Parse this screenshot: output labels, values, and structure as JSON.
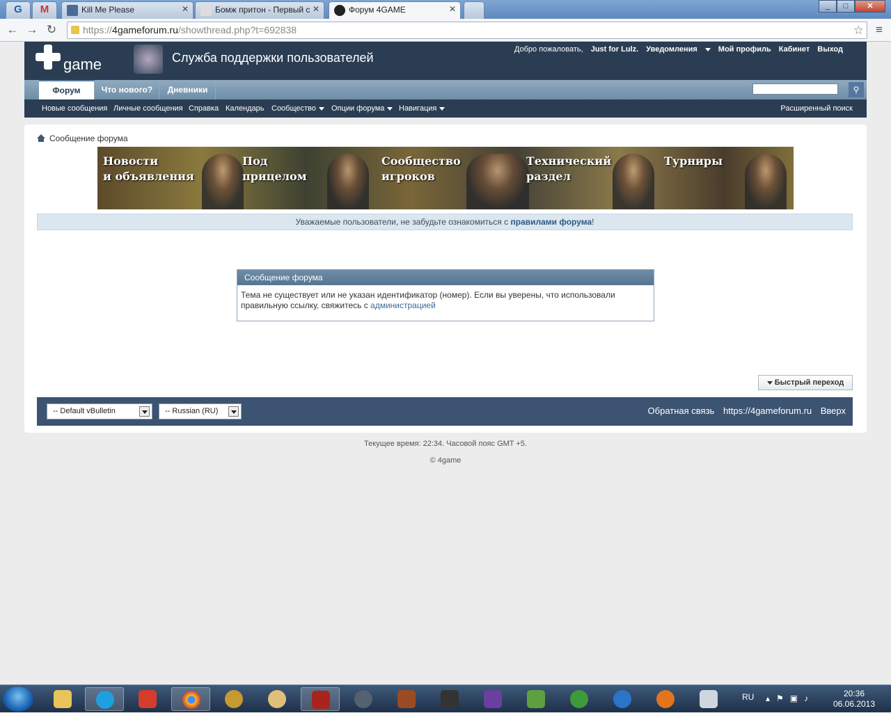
{
  "browser": {
    "tabs": [
      {
        "title": "",
        "icon": "4game-g-icon"
      },
      {
        "title": "",
        "icon": "gmail-icon"
      },
      {
        "title": "Kill Me Please",
        "icon": "video-icon"
      },
      {
        "title": "Бомж притон - Первый с",
        "icon": "page-icon"
      },
      {
        "title": "Форум 4GAME",
        "icon": "4game-plus-icon"
      }
    ],
    "url_scheme": "https://",
    "url_host": "4gameforum.ru",
    "url_path": "/showthread.php?t=692838"
  },
  "header": {
    "logo_text": "game",
    "site_title": "Служба поддержки пользователей",
    "welcome": "Добро пожаловать,",
    "username": "Just for Lulz.",
    "notifications": "Уведомления",
    "profile": "Мой профиль",
    "cabinet": "Кабинет",
    "logout": "Выход"
  },
  "navbar": {
    "tabs": [
      "Форум",
      "Что нового?",
      "Дневники"
    ],
    "search_placeholder": ""
  },
  "subnav": {
    "items": [
      "Новые сообщения",
      "Личные сообщения",
      "Справка",
      "Календарь",
      "Сообщество",
      "Опции форума",
      "Навигация"
    ],
    "advanced_search": "Расширенный поиск"
  },
  "breadcrumb": "Сообщение форума",
  "banner": {
    "labels": [
      "Новости\nи объявления",
      "Под\nприцелом",
      "Сообщество\nигроков",
      "Технический\nраздел",
      "Турниры"
    ]
  },
  "notice": {
    "text": "Уважаемые пользователи, не забудьте ознакомиться с ",
    "link": "правилами форума",
    "suffix": "!"
  },
  "message": {
    "title": "Сообщение форума",
    "body": "Тема не существует или не указан идентификатор (номер). Если вы уверены, что использовали правильную ссылку, свяжитесь с ",
    "link": "администрацией"
  },
  "quickjump": "Быстрый переход",
  "footer": {
    "style_select": "-- Default vBulletin",
    "lang_select": "-- Russian (RU)",
    "links": [
      "Обратная связь",
      "https://4gameforum.ru",
      "Вверх"
    ],
    "time_info": "Текущее время: 22:34. Часовой пояс GMT +5.",
    "copyright": "© 4game"
  },
  "taskbar": {
    "lang": "RU",
    "time": "20:36",
    "date": "06.06.2013"
  }
}
